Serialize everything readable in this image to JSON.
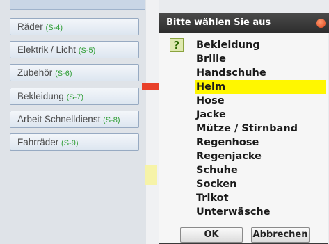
{
  "categories": [
    {
      "label": "Räder",
      "code": "(S-4)"
    },
    {
      "label": "Elektrik / Licht",
      "code": "(S-5)"
    },
    {
      "label": "Zubehör",
      "code": "(S-6)"
    },
    {
      "label": "Bekleidung",
      "code": "(S-7)"
    },
    {
      "label": "Arbeit Schnelldienst",
      "code": "(S-8)"
    },
    {
      "label": "Fahrräder",
      "code": "(S-9)"
    }
  ],
  "dialog": {
    "title": "Bitte wählen Sie aus",
    "icon": "question-icon",
    "options": [
      "Bekleidung",
      "Brille",
      "Handschuhe",
      "Helm",
      "Hose",
      "Jacke",
      "Mütze / Stirnband",
      "Regenhose",
      "Regenjacke",
      "Schuhe",
      "Socken",
      "Trikot",
      "Unterwäsche"
    ],
    "selected": "Helm",
    "ok_label": "OK",
    "cancel_label": "Abbrechen"
  },
  "colors": {
    "selection": "#fff700",
    "arrow": "#e8402a",
    "code_text": "#2f9e35",
    "title_bar": "#3a3a3a"
  }
}
